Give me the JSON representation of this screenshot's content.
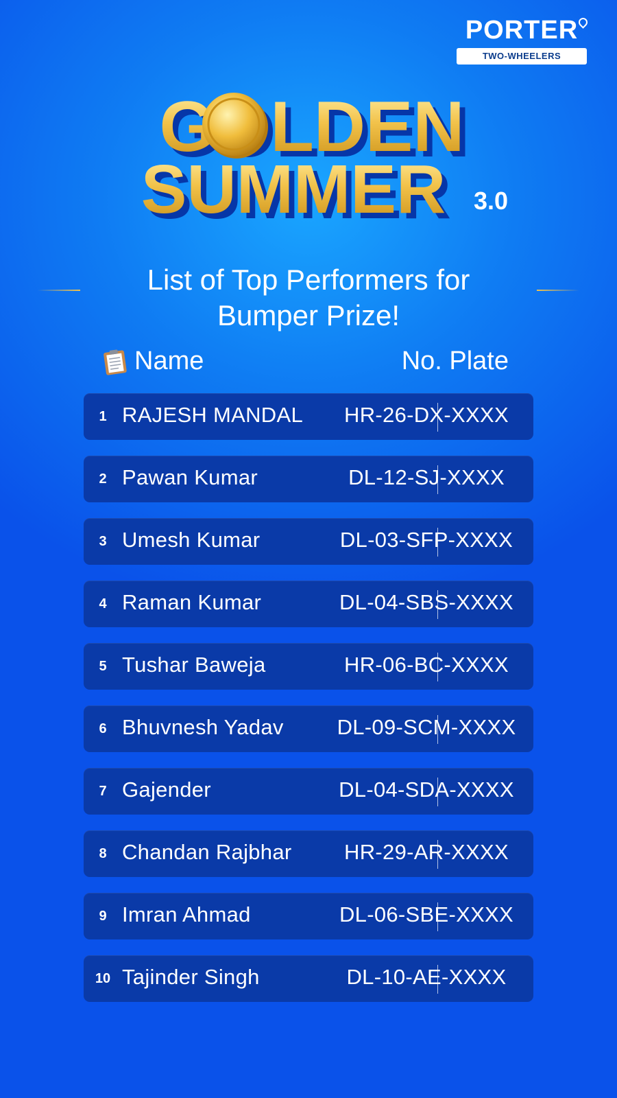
{
  "brand": {
    "name": "PORTER",
    "sub": "TWO-WHEELERS"
  },
  "logo": {
    "line1": "GOLDEN",
    "line2": "SUMMER",
    "version": "3.0"
  },
  "subtitle": {
    "line1": "List of Top Performers for",
    "line2": "Bumper Prize!"
  },
  "headers": {
    "name": "Name",
    "plate": "No. Plate"
  },
  "colors": {
    "background": "#0a52ea",
    "row": "#0a3aa8",
    "gold": "#f2c24a"
  },
  "performers": [
    {
      "rank": "1",
      "name": "RAJESH MANDAL",
      "plate": "HR-26-DX-XXXX"
    },
    {
      "rank": "2",
      "name": "Pawan Kumar",
      "plate": "DL-12-SJ-XXXX"
    },
    {
      "rank": "3",
      "name": "Umesh Kumar",
      "plate": "DL-03-SFP-XXXX"
    },
    {
      "rank": "4",
      "name": "Raman Kumar",
      "plate": "DL-04-SBS-XXXX"
    },
    {
      "rank": "5",
      "name": "Tushar Baweja",
      "plate": "HR-06-BC-XXXX"
    },
    {
      "rank": "6",
      "name": "Bhuvnesh Yadav",
      "plate": "DL-09-SCM-XXXX"
    },
    {
      "rank": "7",
      "name": "Gajender",
      "plate": "DL-04-SDA-XXXX"
    },
    {
      "rank": "8",
      "name": "Chandan Rajbhar",
      "plate": "HR-29-AR-XXXX"
    },
    {
      "rank": "9",
      "name": "Imran Ahmad",
      "plate": "DL-06-SBE-XXXX"
    },
    {
      "rank": "10",
      "name": "Tajinder Singh",
      "plate": "DL-10-AE-XXXX"
    }
  ]
}
